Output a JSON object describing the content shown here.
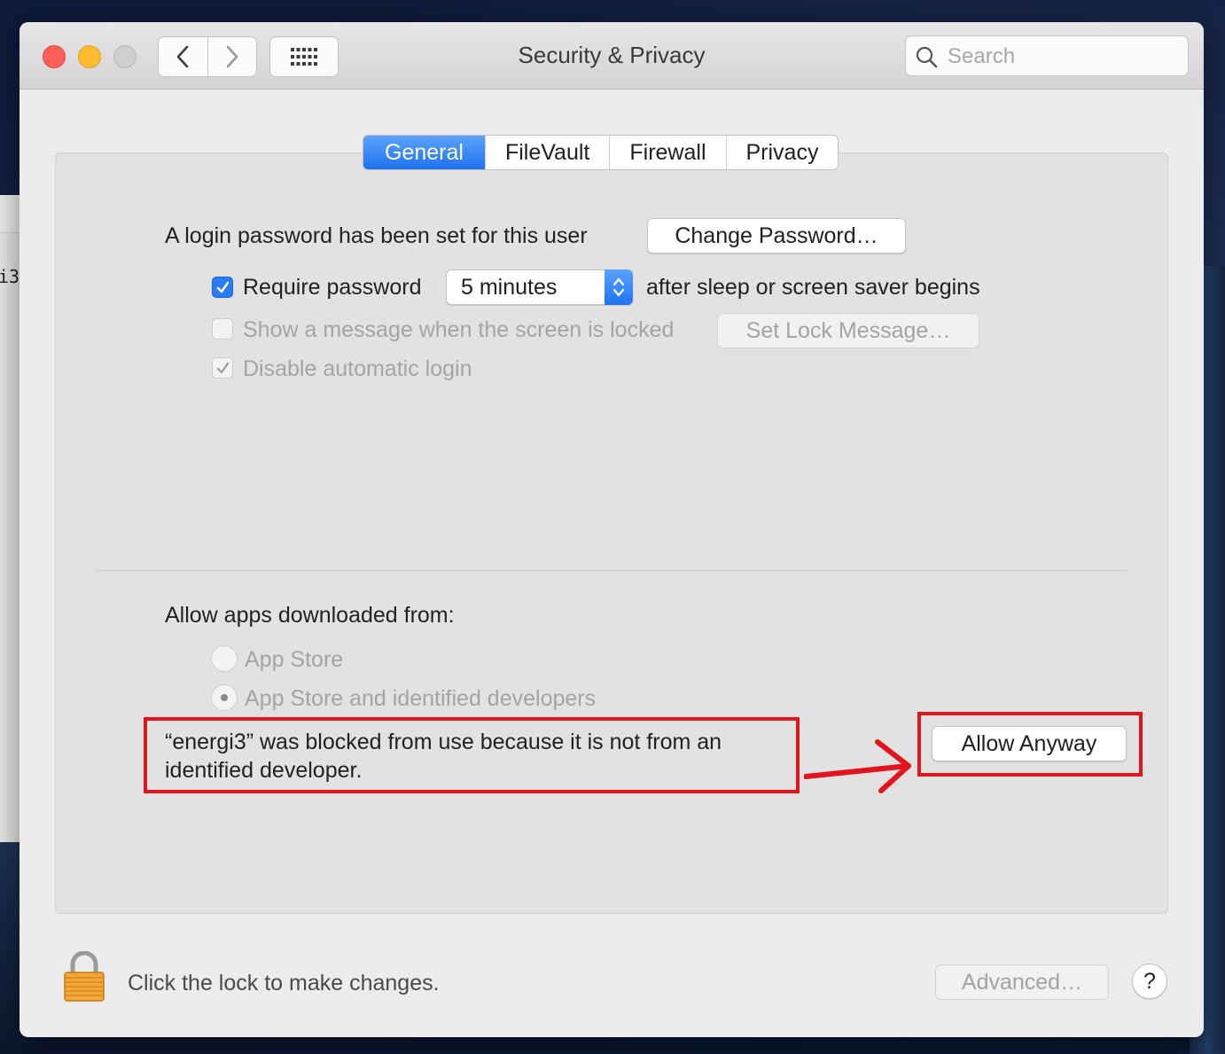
{
  "window": {
    "title": "Security & Privacy"
  },
  "toolbar": {
    "search_placeholder": "Search"
  },
  "background_window": {
    "text": "i3"
  },
  "tabs": [
    {
      "label": "General",
      "active": true
    },
    {
      "label": "FileVault",
      "active": false
    },
    {
      "label": "Firewall",
      "active": false
    },
    {
      "label": "Privacy",
      "active": false
    }
  ],
  "general": {
    "login_password_text": "A login password has been set for this user",
    "change_password_button": "Change Password…",
    "require_password": {
      "label": "Require password",
      "checked": true
    },
    "require_password_delay": "5 minutes",
    "after_sleep_text": "after sleep or screen saver begins",
    "show_message": {
      "label": "Show a message when the screen is locked",
      "checked": false,
      "enabled": false
    },
    "set_lock_message_button": "Set Lock Message…",
    "disable_auto_login": {
      "label": "Disable automatic login",
      "checked": true,
      "enabled": false
    }
  },
  "allow_apps": {
    "heading": "Allow apps downloaded from:",
    "options": [
      {
        "label": "App Store",
        "selected": false
      },
      {
        "label": "App Store and identified developers",
        "selected": true
      }
    ],
    "blocked_message": "“energi3” was blocked from use because it is not from an identified developer.",
    "allow_anyway_button": "Allow Anyway"
  },
  "footer": {
    "lock_message": "Click the lock to make changes.",
    "advanced_button": "Advanced…",
    "help_button": "?"
  },
  "colors": {
    "accent": "#2a7cf4",
    "annotation": "#e3141e"
  }
}
